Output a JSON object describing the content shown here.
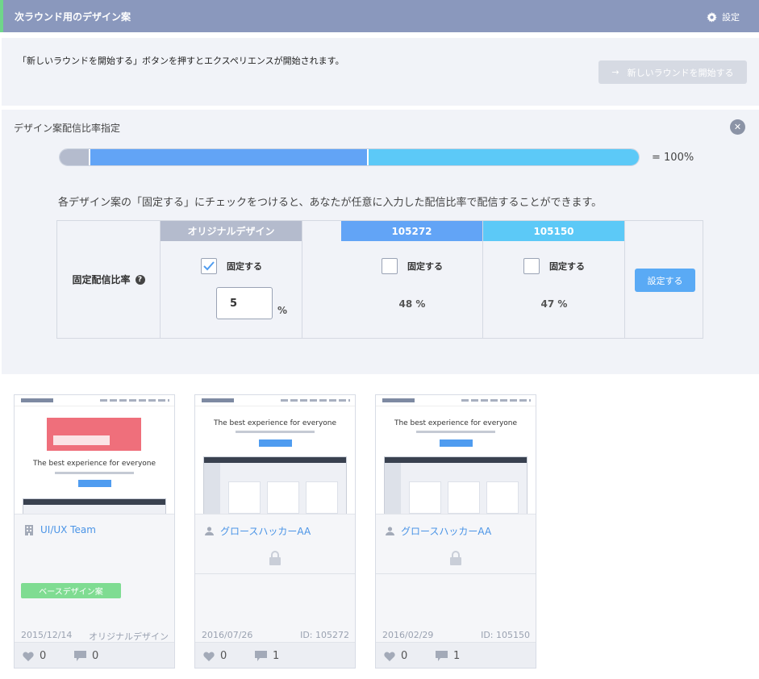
{
  "header": {
    "title": "次ラウンド用のデザイン案",
    "settings_label": "設定",
    "accent": "#6fd68a",
    "bg": "#8a98bd"
  },
  "intro": {
    "text": "「新しいラウンドを開始する」ボタンを押すとエクスペリエンスが開始されます。",
    "start_button": "新しいラウンドを開始する"
  },
  "distribution": {
    "title": "デザイン案配信比率指定",
    "total_label": "= 100%",
    "bar_segments": [
      {
        "variant": "オリジナルデザイン",
        "percent": 5,
        "color": "#b4bbcd"
      },
      {
        "variant": "105272",
        "percent": 48,
        "color": "#62a4f6"
      },
      {
        "variant": "105150",
        "percent": 47,
        "color": "#5cc9f7"
      }
    ],
    "description": "各デザイン案の「固定する」にチェックをつけると、あなたが任意に入力した配信比率で配信することができます。",
    "row_label": "固定配信比率",
    "fix_label": "固定する",
    "columns": [
      {
        "name": "オリジナルデザイン",
        "color": "#b4bbcd",
        "fixed": true,
        "value": "5",
        "unit": "%"
      },
      {
        "name": "105272",
        "color": "#62a4f6",
        "fixed": false,
        "value": "48 %"
      },
      {
        "name": "105150",
        "color": "#5cc9f7",
        "fixed": false,
        "value": "47 %"
      }
    ],
    "set_button": "設定する"
  },
  "cards": [
    {
      "hero_text": "The best experience for everyone",
      "owner": "UI/UX Team",
      "owner_icon": "building-icon",
      "badge": "ベースデザイン案",
      "date": "2015/12/14",
      "id_label": "オリジナルデザイン",
      "likes": "0",
      "comments": "0"
    },
    {
      "hero_text": "The best experience for everyone",
      "owner": "グロースハッカーAA",
      "owner_icon": "user-icon",
      "date": "2016/07/26",
      "id_label": "ID: 105272",
      "likes": "0",
      "comments": "1"
    },
    {
      "hero_text": "The best experience for everyone",
      "owner": "グロースハッカーAA",
      "owner_icon": "user-icon",
      "date": "2016/02/29",
      "id_label": "ID: 105150",
      "likes": "0",
      "comments": "1"
    }
  ]
}
